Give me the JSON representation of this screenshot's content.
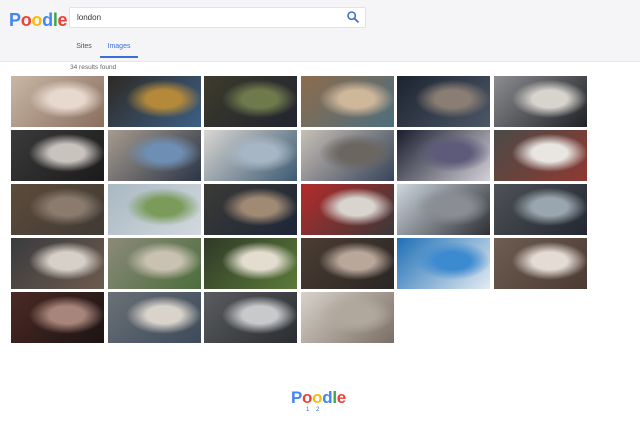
{
  "app": {
    "logo_letters": [
      "P",
      "o",
      "o",
      "d",
      "l",
      "e"
    ],
    "logo_colors": [
      "#4285f4",
      "#ea4335",
      "#fbbc05",
      "#4285f4",
      "#34a853",
      "#ea4335"
    ]
  },
  "search": {
    "query": "london",
    "icon": "search-icon"
  },
  "tabs": [
    {
      "label": "Sites",
      "active": false
    },
    {
      "label": "Images",
      "active": true
    }
  ],
  "results": {
    "count_text": "34 results found",
    "thumbnails": [
      {
        "colors": [
          "#c9b7a6",
          "#e8d9cf",
          "#8a6e5e"
        ]
      },
      {
        "colors": [
          "#2e2a24",
          "#b48a3a",
          "#3d5f86"
        ]
      },
      {
        "colors": [
          "#3c3b2b",
          "#6f7a4c",
          "#222431"
        ]
      },
      {
        "colors": [
          "#8d6c4d",
          "#cfb79a",
          "#4d6e7d"
        ]
      },
      {
        "colors": [
          "#1d2330",
          "#8a7e74",
          "#4c5767"
        ]
      },
      {
        "colors": [
          "#8b8d90",
          "#d7d3cd",
          "#1f2126"
        ]
      },
      {
        "colors": [
          "#3a3a3a",
          "#c9c3bd",
          "#1b1b1b"
        ]
      },
      {
        "colors": [
          "#a69b8f",
          "#6e8fb3",
          "#2b3546"
        ]
      },
      {
        "colors": [
          "#d9d6d2",
          "#a7b6c4",
          "#3c5a73"
        ]
      },
      {
        "colors": [
          "#c8c0b6",
          "#6b6660",
          "#37445a"
        ]
      },
      {
        "colors": [
          "#1a1d2e",
          "#5d5a7a",
          "#d3d0d8"
        ]
      },
      {
        "colors": [
          "#4b4a47",
          "#e9e6e2",
          "#8d3a32"
        ]
      },
      {
        "colors": [
          "#5d4b3b",
          "#8a7b6e",
          "#3f3a34"
        ]
      },
      {
        "colors": [
          "#a9b8c2",
          "#7a9b5a",
          "#d2d9de"
        ]
      },
      {
        "colors": [
          "#3b3a36",
          "#a18a74",
          "#1d2638"
        ]
      },
      {
        "colors": [
          "#b52b2b",
          "#d9d4ce",
          "#3a3838"
        ]
      },
      {
        "colors": [
          "#cfd6de",
          "#8a8d92",
          "#2c2f34"
        ]
      },
      {
        "colors": [
          "#4f5257",
          "#9aa6af",
          "#222831"
        ]
      },
      {
        "colors": [
          "#3a3b3e",
          "#d6d0c8",
          "#6c5b4d"
        ]
      },
      {
        "colors": [
          "#8c8a7a",
          "#c9c2b2",
          "#4c6d3c"
        ]
      },
      {
        "colors": [
          "#2f3a27",
          "#e3ddd0",
          "#5b7a3a"
        ]
      },
      {
        "colors": [
          "#4b3d33",
          "#b9a79a",
          "#2a2624"
        ]
      },
      {
        "colors": [
          "#1f6fb6",
          "#3c8ad0",
          "#e4ebf2"
        ]
      },
      {
        "colors": [
          "#6d5d52",
          "#e4dcd4",
          "#4a3a32"
        ]
      },
      {
        "colors": [
          "#4c2a24",
          "#a8857a",
          "#1b1413"
        ]
      },
      {
        "colors": [
          "#6a7076",
          "#d9d3cb",
          "#3c4a5a"
        ]
      },
      {
        "colors": [
          "#5a5c5f",
          "#c7c9cb",
          "#2a2d31"
        ]
      },
      {
        "colors": [
          "#d8d2ca",
          "#b1a89d",
          "#7a6e64"
        ]
      }
    ]
  },
  "footer": {
    "logo_letters": [
      "P",
      "o",
      "o",
      "d",
      "l",
      "e"
    ],
    "pages": [
      "1",
      "2"
    ]
  }
}
